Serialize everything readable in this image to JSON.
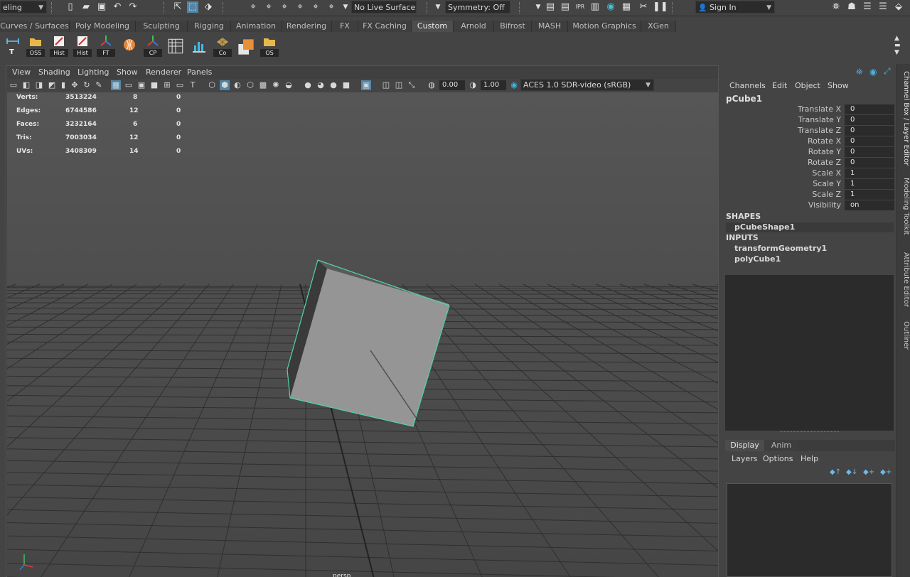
{
  "status_line": {
    "mode_menu": "eling",
    "live_surface": "No Live Surface",
    "symmetry": "Symmetry: Off",
    "sign_in": "Sign In"
  },
  "shelf_tabs": [
    "Curves / Surfaces",
    "Poly Modeling",
    "Sculpting",
    "Rigging",
    "Animation",
    "Rendering",
    "FX",
    "FX Caching",
    "Custom",
    "Arnold",
    "Bifrost",
    "MASH",
    "Motion Graphics",
    "XGen"
  ],
  "active_shelf_tab": "Custom",
  "shelf_buttons": [
    {
      "label": "T",
      "icon": "measure-icon"
    },
    {
      "label": "OSS",
      "icon": "folder-icon"
    },
    {
      "label": "Hist",
      "icon": "history-icon"
    },
    {
      "label": "Hist",
      "icon": "history-icon"
    },
    {
      "label": "FT",
      "icon": "freeze-transform-icon"
    },
    {
      "label": "",
      "icon": "ball-icon"
    },
    {
      "label": "CP",
      "icon": "center-pivot-icon"
    },
    {
      "label": "",
      "icon": "grid-icon"
    },
    {
      "label": "",
      "icon": "bars-icon"
    },
    {
      "label": "Co",
      "icon": "plane-icon"
    },
    {
      "label": "",
      "icon": "box-icon"
    },
    {
      "label": "OS",
      "icon": "folder-icon"
    }
  ],
  "viewport": {
    "menu": [
      "View",
      "Shading",
      "Lighting",
      "Show",
      "Renderer",
      "Panels"
    ],
    "exposure": "0.00",
    "gamma": "1.00",
    "color_space": "ACES 1.0 SDR-video (sRGB)",
    "camera_label": "persp",
    "hud": [
      {
        "label": "Verts:",
        "total": "3513224",
        "selected": "8",
        "third": "0"
      },
      {
        "label": "Edges:",
        "total": "6744586",
        "selected": "12",
        "third": "0"
      },
      {
        "label": "Faces:",
        "total": "3232164",
        "selected": "6",
        "third": "0"
      },
      {
        "label": "Tris:",
        "total": "7003034",
        "selected": "12",
        "third": "0"
      },
      {
        "label": "UVs:",
        "total": "3408309",
        "selected": "14",
        "third": "0"
      }
    ]
  },
  "channel_box": {
    "menu": [
      "Channels",
      "Edit",
      "Object",
      "Show"
    ],
    "object_name": "pCube1",
    "channels": [
      {
        "name": "Translate X",
        "value": "0"
      },
      {
        "name": "Translate Y",
        "value": "0"
      },
      {
        "name": "Translate Z",
        "value": "0"
      },
      {
        "name": "Rotate X",
        "value": "0"
      },
      {
        "name": "Rotate Y",
        "value": "0"
      },
      {
        "name": "Rotate Z",
        "value": "0"
      },
      {
        "name": "Scale X",
        "value": "1"
      },
      {
        "name": "Scale Y",
        "value": "1"
      },
      {
        "name": "Scale Z",
        "value": "1"
      },
      {
        "name": "Visibility",
        "value": "on"
      }
    ],
    "shapes_header": "SHAPES",
    "shape": "pCubeShape1",
    "inputs_header": "INPUTS",
    "inputs": [
      "transformGeometry1",
      "polyCube1"
    ]
  },
  "layer_editor": {
    "tabs": [
      "Display",
      "Anim"
    ],
    "menu": [
      "Layers",
      "Options",
      "Help"
    ]
  },
  "side_tabs": [
    "Channel Box / Layer Editor",
    "Modeling Toolkit",
    "Attribute Editor",
    "Outliner"
  ],
  "colors": {
    "selection": "#5285a6",
    "highlight": "#4fd6a3"
  }
}
